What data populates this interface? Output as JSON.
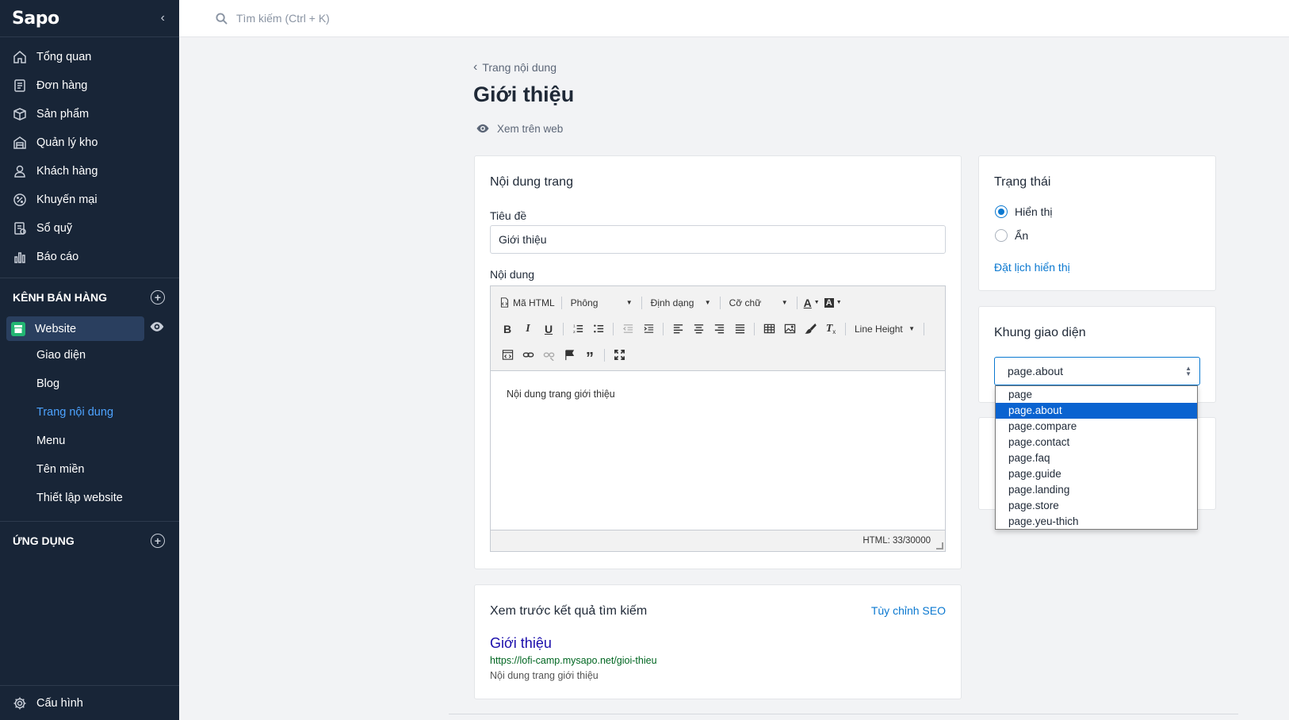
{
  "app": {
    "logo": "Sapo"
  },
  "search": {
    "placeholder": "Tìm kiếm (Ctrl + K)"
  },
  "sidebar": {
    "items": [
      {
        "label": "Tổng quan",
        "icon": "home-icon"
      },
      {
        "label": "Đơn hàng",
        "icon": "order-icon"
      },
      {
        "label": "Sản phẩm",
        "icon": "box-icon"
      },
      {
        "label": "Quản lý kho",
        "icon": "warehouse-icon"
      },
      {
        "label": "Khách hàng",
        "icon": "user-icon"
      },
      {
        "label": "Khuyến mại",
        "icon": "percent-icon"
      },
      {
        "label": "Sổ quỹ",
        "icon": "ledger-icon"
      },
      {
        "label": "Báo cáo",
        "icon": "chart-icon"
      }
    ],
    "sales_channels_label": "KÊNH BÁN HÀNG",
    "website_label": "Website",
    "website_sub": [
      "Giao diện",
      "Blog",
      "Trang nội dung",
      "Menu",
      "Tên miền",
      "Thiết lập website"
    ],
    "apps_label": "ỨNG DỤNG",
    "config_label": "Cấu hình"
  },
  "page": {
    "back_label": "Trang nội dung",
    "title": "Giới thiệu",
    "view_web": "Xem trên web"
  },
  "content_card": {
    "title": "Nội dung trang",
    "title_label": "Tiêu đề",
    "title_value": "Giới thiệu",
    "content_label": "Nội dung",
    "editor": {
      "html_btn": "Mã HTML",
      "font_drop": "Phông",
      "format_drop": "Định dạng",
      "size_drop": "Cỡ chữ",
      "line_height": "Line Height",
      "body": "Nội dung trang giới thiệu",
      "counter": "HTML: 33/30000"
    }
  },
  "seo_card": {
    "title": "Xem trước kết quả tìm kiếm",
    "customize": "Tùy chỉnh SEO",
    "preview_title": "Giới thiệu",
    "preview_url": "https://lofi-camp.mysapo.net/gioi-thieu",
    "preview_desc": "Nội dung trang giới thiệu"
  },
  "status_card": {
    "title": "Trạng thái",
    "options": [
      "Hiển thị",
      "Ẩn"
    ],
    "selected": "Hiển thị",
    "schedule": "Đặt lịch hiển thị"
  },
  "layout_card": {
    "title": "Khung giao diện",
    "selected": "page.about",
    "options": [
      "page",
      "page.about",
      "page.compare",
      "page.contact",
      "page.faq",
      "page.guide",
      "page.landing",
      "page.store",
      "page.yeu-thich"
    ]
  },
  "colors": {
    "sidebar": "#182537",
    "accent": "#0a78d0",
    "active_link": "#4da3ff",
    "website_icon": "#22b573"
  }
}
